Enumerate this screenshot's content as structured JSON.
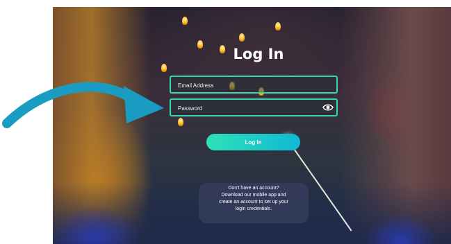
{
  "login": {
    "title": "Log In",
    "email": {
      "placeholder": "Email Address",
      "value": ""
    },
    "password": {
      "placeholder": "Password",
      "value": ""
    },
    "submit_label": "Log In",
    "info": [
      "Don't have an account?",
      "Download our mobile app and",
      "create an account to set up your",
      "login credentials."
    ]
  },
  "icons": {
    "password_toggle": "eye-icon",
    "annotation": "arrow-icon"
  },
  "colors": {
    "field_border": "#37d6b6",
    "button_start": "#2fe1b7",
    "button_end": "#10b8d4",
    "arrow": "#1a9bc2",
    "info_box": "#343c5c"
  }
}
